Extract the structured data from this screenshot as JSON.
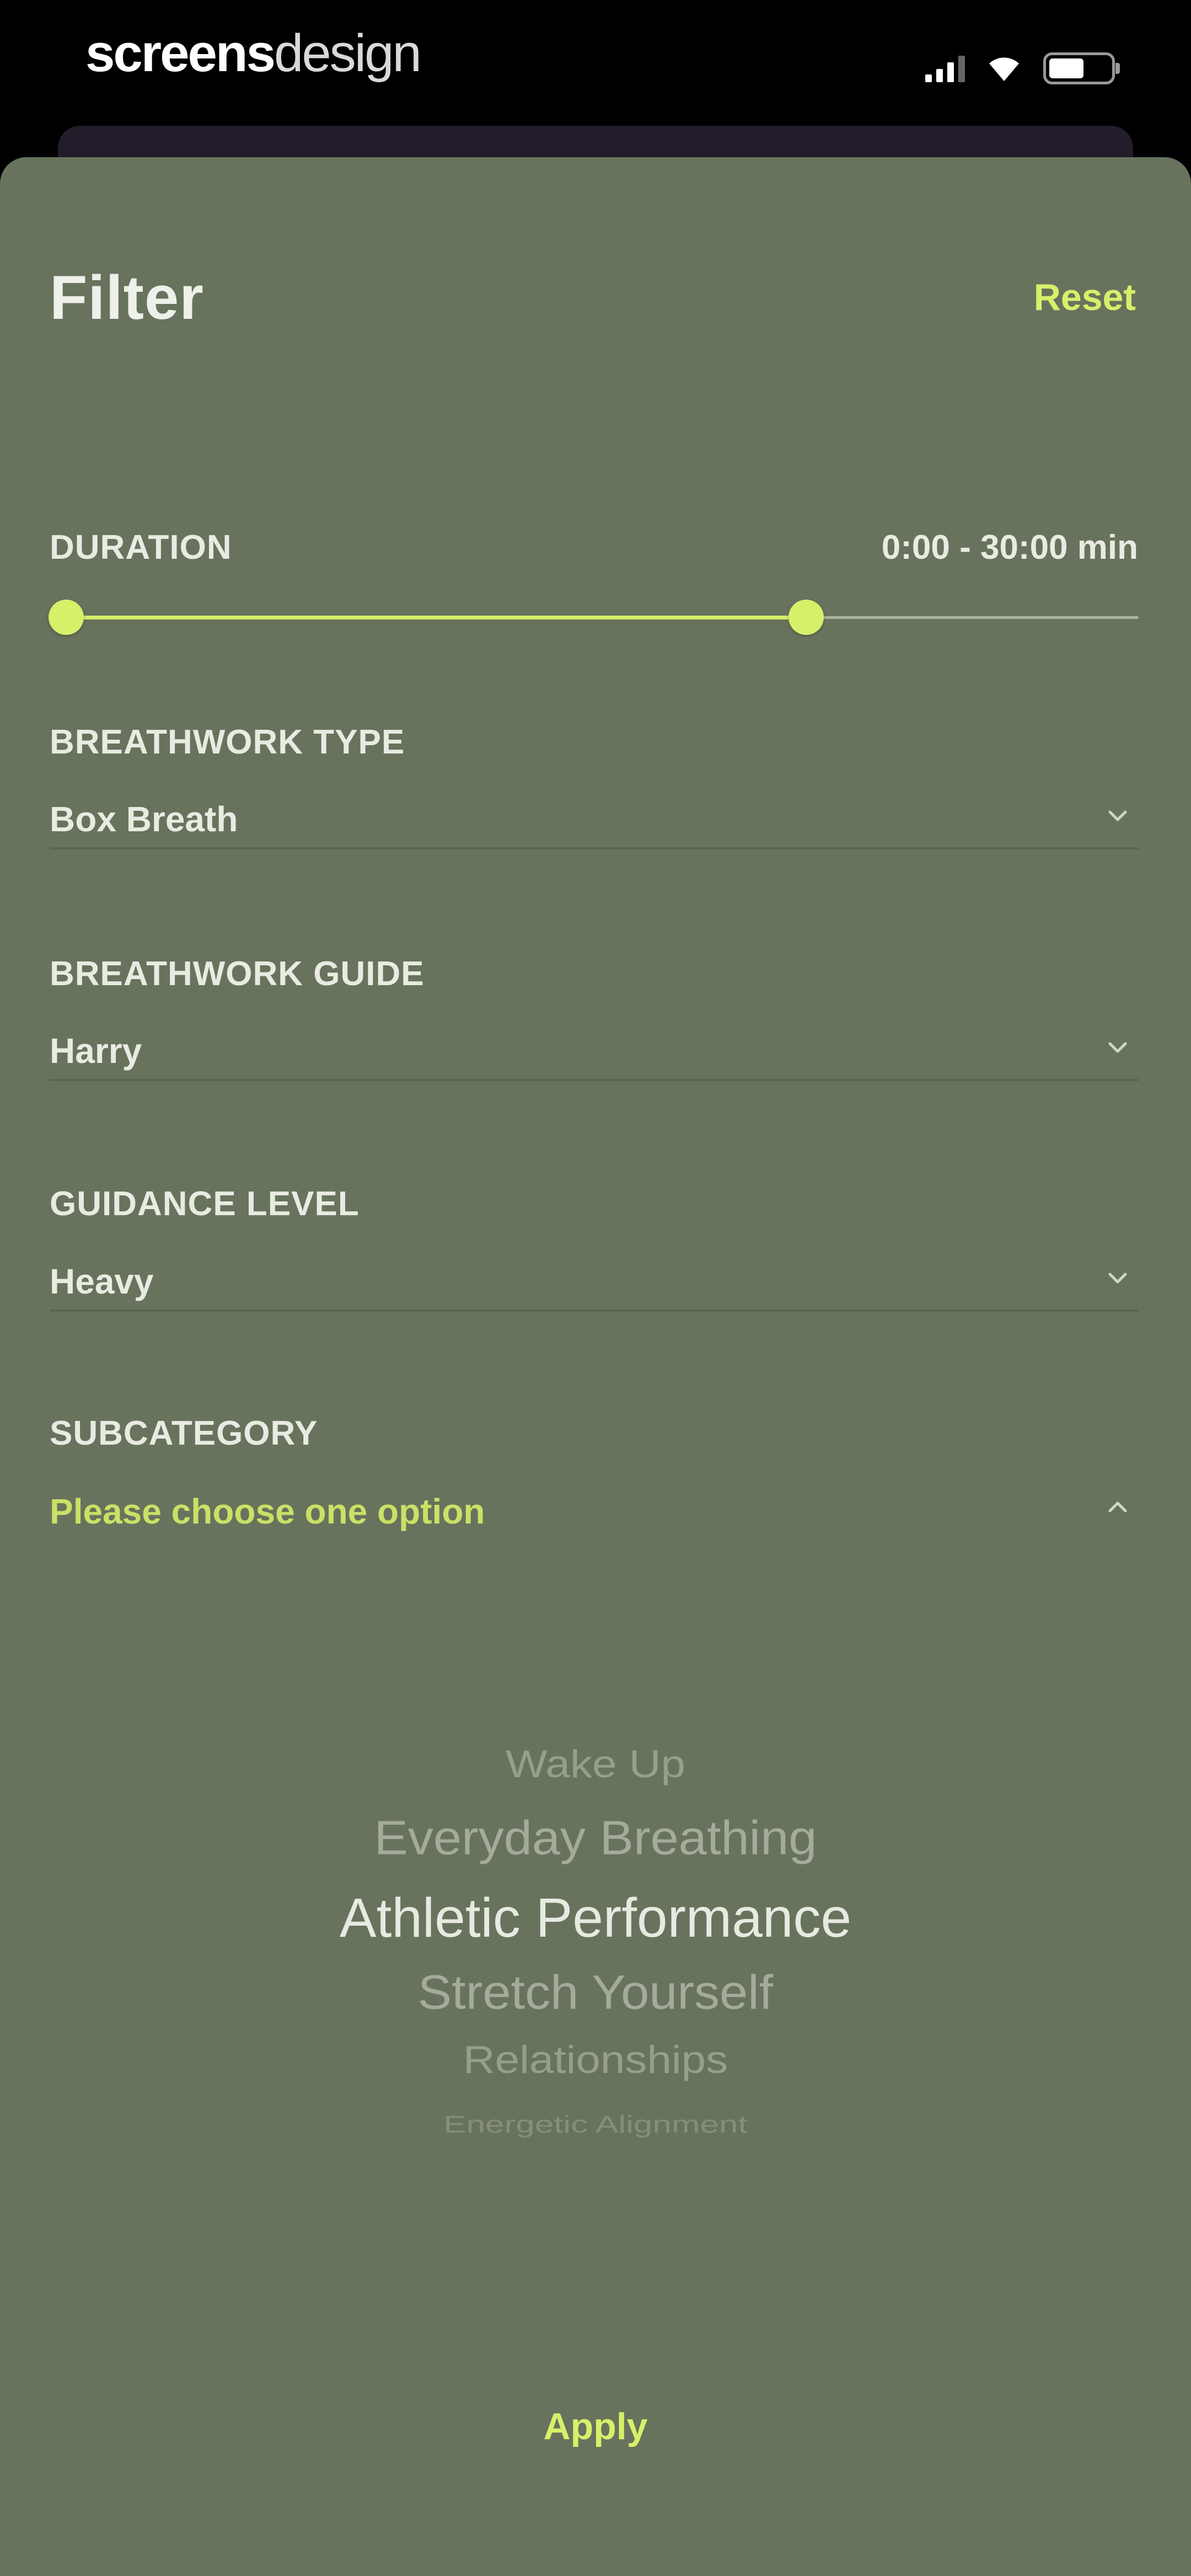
{
  "status_bar": {
    "brand_bold": "screens",
    "brand_light": "design",
    "icons": [
      "signal-icon",
      "wifi-icon",
      "battery-icon"
    ]
  },
  "filter": {
    "title": "Filter",
    "reset_label": "Reset",
    "duration": {
      "label": "DURATION",
      "value_text": "0:00 - 30:00 min",
      "min_fraction": 0.0,
      "max_fraction": 0.69
    },
    "breathwork_type": {
      "label": "BREATHWORK TYPE",
      "value": "Box Breath"
    },
    "breathwork_guide": {
      "label": "BREATHWORK GUIDE",
      "value": "Harry"
    },
    "guidance_level": {
      "label": "GUIDANCE LEVEL",
      "value": "Heavy"
    },
    "subcategory": {
      "label": "SUBCATEGORY",
      "placeholder": "Please choose one option"
    },
    "picker": {
      "selected": "Athletic Performance",
      "options": [
        "Wake Up",
        "Everyday Breathing",
        "Athletic Performance",
        "Stretch Yourself",
        "Relationships",
        "Energetic Alignment"
      ]
    },
    "apply_label": "Apply"
  },
  "colors": {
    "sheet_background": "#68735d",
    "accent": "#d6f06a",
    "text": "#e8ebe2",
    "status_background": "#000000"
  }
}
